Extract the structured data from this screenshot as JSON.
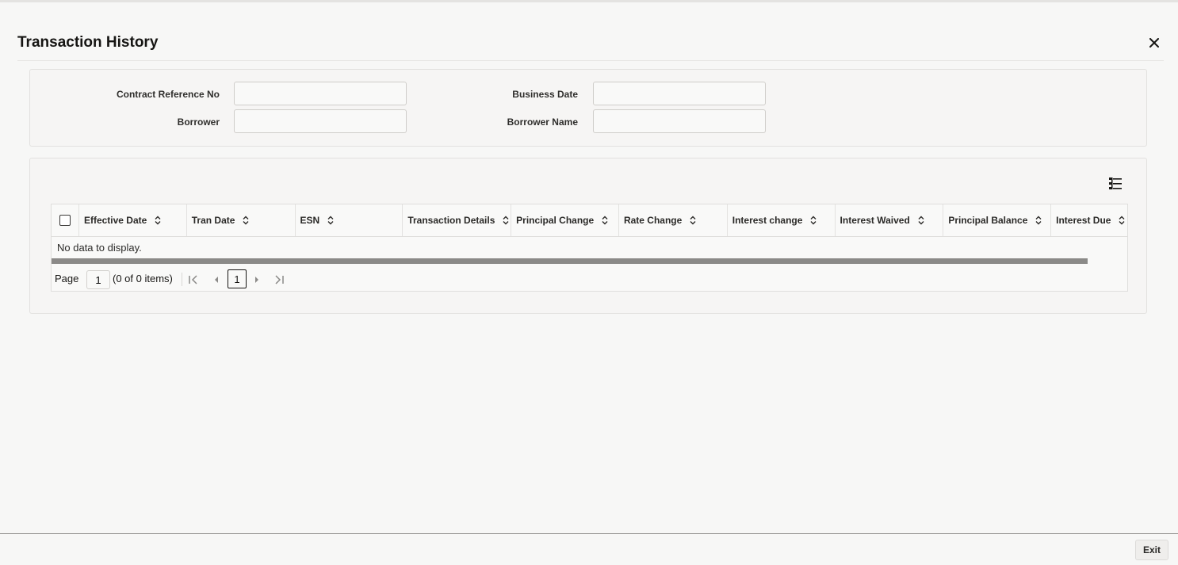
{
  "window": {
    "title": "Transaction History",
    "close_icon": "close-icon"
  },
  "form": {
    "contract_ref": {
      "label": "Contract Reference No",
      "value": "",
      "placeholder": ""
    },
    "business_date": {
      "label": "Business Date",
      "value": "",
      "placeholder": ""
    },
    "borrower": {
      "label": "Borrower",
      "value": "",
      "placeholder": ""
    },
    "borrower_name": {
      "label": "Borrower Name",
      "value": "",
      "placeholder": ""
    }
  },
  "grid": {
    "columns_icon": "column-management-icon",
    "columns": [
      "Effective Date",
      "Tran Date",
      "ESN",
      "Transaction Details",
      "Principal Change",
      "Rate Change",
      "Interest change",
      "Interest Waived",
      "Principal Balance",
      "Interest Due"
    ],
    "rows": [],
    "empty_message": "No data to display."
  },
  "pagination": {
    "page_label": "Page",
    "current_page": "1",
    "count_text": "(0 of 0 items)",
    "page_button": "1"
  },
  "footer": {
    "exit_label": "Exit"
  },
  "colors": {
    "background": "#f7f7f6",
    "text": "#161513",
    "border": "#dfdedc"
  }
}
